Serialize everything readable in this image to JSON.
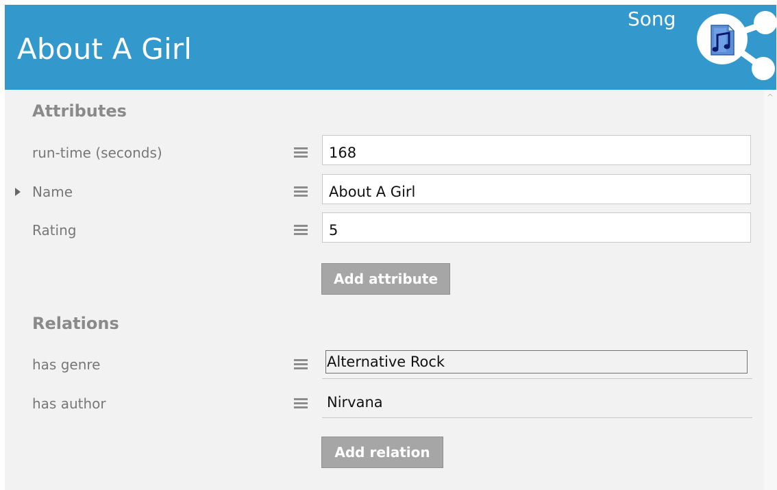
{
  "header": {
    "title": "About A Girl",
    "type_label": "Song",
    "icon": "music-document-share-icon",
    "background_color": "#3399cc"
  },
  "attributes": {
    "section_title": "Attributes",
    "rows": [
      {
        "label": "run-time (seconds)",
        "value": "168"
      },
      {
        "label": "Name",
        "value": "About A Girl",
        "selected": true
      },
      {
        "label": "Rating",
        "value": "5"
      }
    ],
    "add_button_label": "Add attribute"
  },
  "relations": {
    "section_title": "Relations",
    "rows": [
      {
        "label": "has genre",
        "value": "Alternative Rock",
        "focused": true
      },
      {
        "label": "has author",
        "value": "Nirvana"
      }
    ],
    "add_button_label": "Add relation"
  },
  "icons": {
    "row_menu": "hamburger-menu-icon",
    "selected_row": "caret-right-icon",
    "scroll_up": "chevron-up-icon"
  }
}
